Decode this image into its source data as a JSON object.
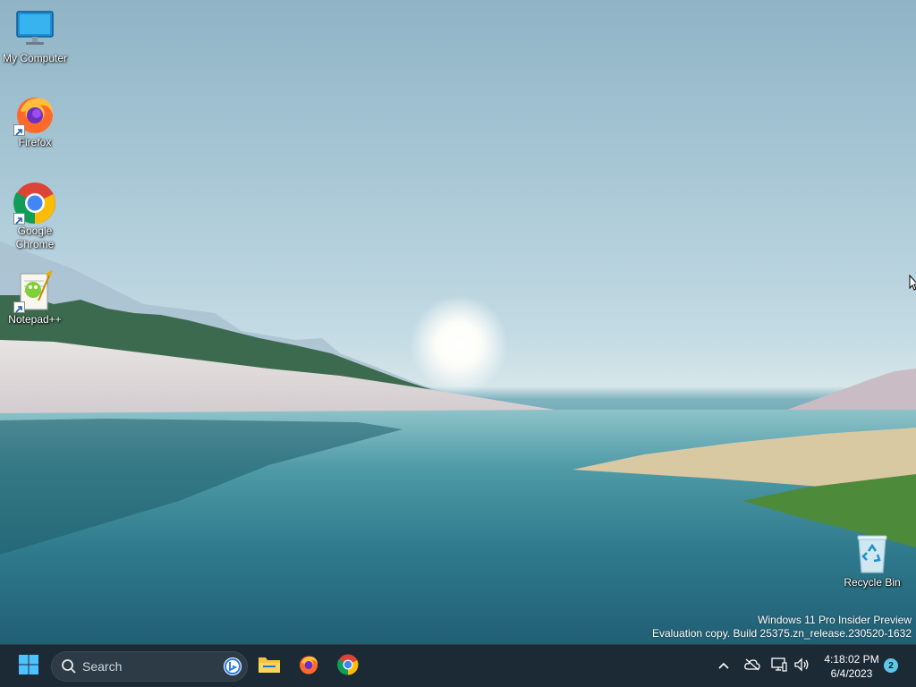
{
  "desktop": {
    "icons": [
      {
        "label": "My Computer",
        "icon": "monitor-icon"
      },
      {
        "label": "Firefox",
        "icon": "firefox-icon"
      },
      {
        "label": "Google Chrome",
        "icon": "chrome-icon"
      },
      {
        "label": "Notepad++",
        "icon": "notepadplusplus-icon"
      },
      {
        "label": "Recycle Bin",
        "icon": "recycle-bin-icon"
      }
    ],
    "watermark": {
      "line1": "Windows 11 Pro Insider Preview",
      "line2": "Evaluation copy. Build 25375.zn_release.230520-1632"
    }
  },
  "taskbar": {
    "start_icon": "windows-start-icon",
    "search_placeholder": "Search",
    "pinned": [
      {
        "name": "File Explorer",
        "icon": "folder-icon"
      },
      {
        "name": "Firefox",
        "icon": "firefox-icon"
      },
      {
        "name": "Google Chrome",
        "icon": "chrome-icon"
      }
    ],
    "tray": {
      "icons": [
        "chevron-up-icon",
        "onedrive-offline-icon",
        "network-icon",
        "volume-icon"
      ],
      "time": "4:18:02 PM",
      "date": "6/4/2023",
      "notification_count": "2"
    }
  },
  "colors": {
    "taskbar_bg": "#1c2a35",
    "accent": "#0078d4",
    "badge": "#5ec8e8"
  }
}
